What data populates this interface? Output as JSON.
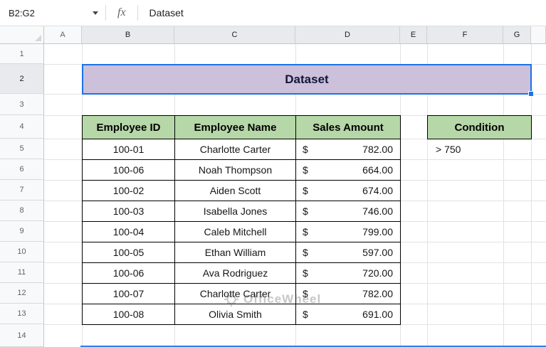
{
  "formula_bar": {
    "name_box": "B2:G2",
    "fx_label": "fx",
    "formula_value": "Dataset"
  },
  "column_headers": [
    "A",
    "B",
    "C",
    "D",
    "E",
    "F",
    "G",
    ""
  ],
  "row_numbers": [
    "1",
    "2",
    "3",
    "4",
    "5",
    "6",
    "7",
    "8",
    "9",
    "10",
    "11",
    "12",
    "13",
    "14"
  ],
  "title_cell": {
    "text": "Dataset"
  },
  "data_table": {
    "headers": {
      "id": "Employee ID",
      "name": "Employee Name",
      "sales": "Sales Amount"
    },
    "rows": [
      {
        "id": "100-01",
        "name": "Charlotte Carter",
        "cur": "$",
        "amount": "782.00"
      },
      {
        "id": "100-06",
        "name": "Noah Thompson",
        "cur": "$",
        "amount": "664.00"
      },
      {
        "id": "100-02",
        "name": "Aiden Scott",
        "cur": "$",
        "amount": "674.00"
      },
      {
        "id": "100-03",
        "name": "Isabella Jones",
        "cur": "$",
        "amount": "746.00"
      },
      {
        "id": "100-04",
        "name": "Caleb Mitchell",
        "cur": "$",
        "amount": "799.00"
      },
      {
        "id": "100-05",
        "name": "Ethan William",
        "cur": "$",
        "amount": "597.00"
      },
      {
        "id": "100-06",
        "name": "Ava Rodriguez",
        "cur": "$",
        "amount": "720.00"
      },
      {
        "id": "100-07",
        "name": "Charlotte Carter",
        "cur": "$",
        "amount": "782.00"
      },
      {
        "id": "100-08",
        "name": "Olivia Smith",
        "cur": "$",
        "amount": "691.00"
      }
    ]
  },
  "condition": {
    "header": "Condition",
    "value": "> 750"
  },
  "watermark": "OfficeWheel",
  "colors": {
    "selection_blue": "#1a73e8",
    "title_fill": "#ccc0da",
    "header_green": "#b6d7a8",
    "grid_line": "#e2e2e2",
    "header_bg": "#f8f9fa",
    "header_selected_bg": "#e8eaed"
  }
}
